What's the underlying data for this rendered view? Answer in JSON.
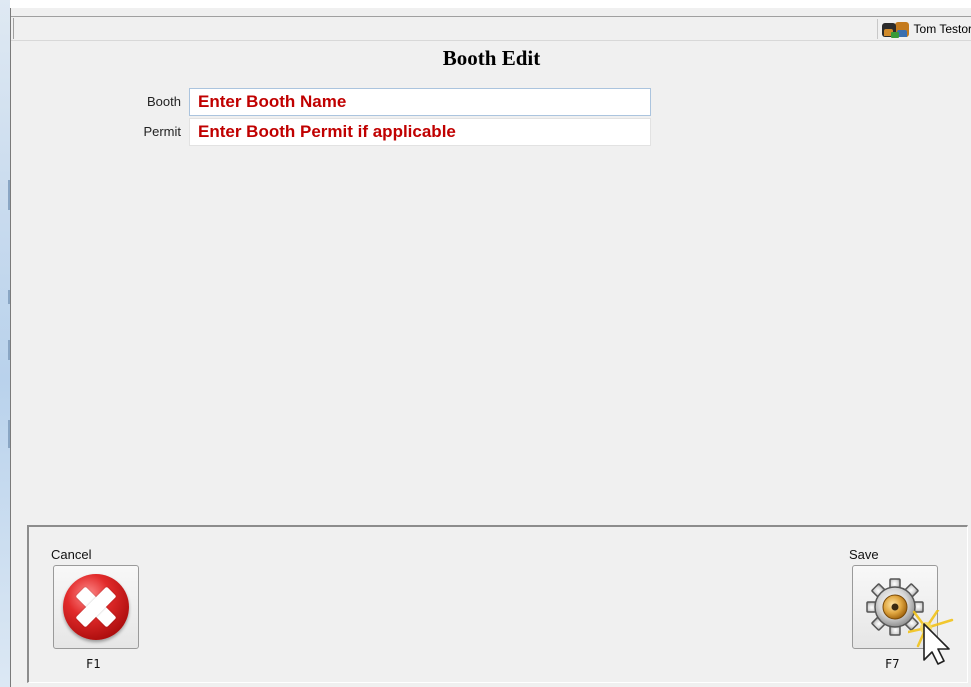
{
  "header": {
    "user_name": "Tom Testor"
  },
  "page": {
    "title": "Booth Edit"
  },
  "form": {
    "booth": {
      "label": "Booth",
      "placeholder": "Enter Booth Name"
    },
    "permit": {
      "label": "Permit",
      "placeholder": "Enter Booth Permit if applicable"
    }
  },
  "actions": {
    "cancel": {
      "label": "Cancel",
      "key": "F1",
      "icon": "cancel-x-icon"
    },
    "save": {
      "label": "Save",
      "key": "F7",
      "icon": "gear-icon"
    }
  },
  "colors": {
    "placeholder_text": "#c00000",
    "window_bg": "#f0f0f0"
  }
}
